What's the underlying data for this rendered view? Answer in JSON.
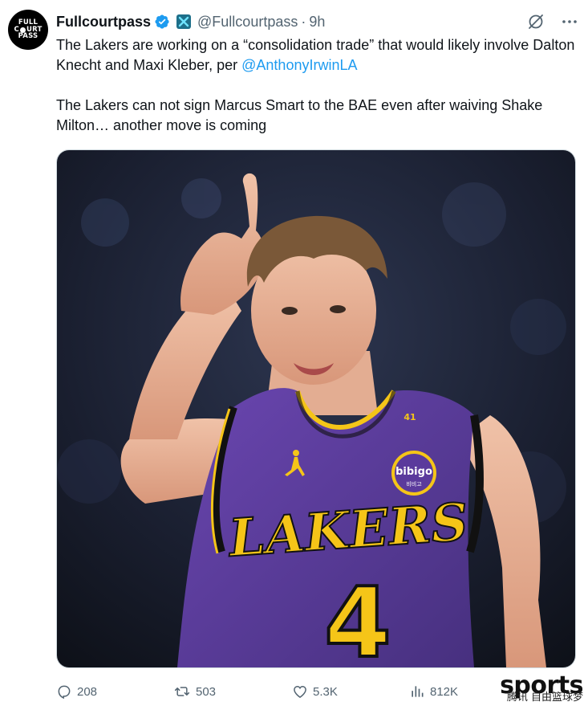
{
  "avatar": {
    "line1": "FULL",
    "line2a": "C",
    "line2b": "URT",
    "line3": "PASS"
  },
  "author": {
    "name": "Fullcourtpass",
    "handle": "@Fullcourtpass",
    "separator": "·",
    "time": "9h"
  },
  "tweet": {
    "p1_text": "The Lakers are working on a “consolidation trade” that would likely involve Dalton Knecht and Maxi Kleber, per ",
    "p1_mention": "@AnthonyIrwinLA",
    "p2_text": "The Lakers can not sign Marcus Smart to the BAE even after waiving Shake Milton… another move is coming"
  },
  "media": {
    "jersey_team": "LAKERS",
    "jersey_number": "4",
    "sponsor": "bibigo",
    "sponsor_sub": "비비고",
    "collar_number": "41"
  },
  "actions": {
    "replies": "208",
    "reposts": "503",
    "likes": "5.3K",
    "views": "812K"
  },
  "watermark": {
    "brand": "sports",
    "source": "腾讯 自由篮球梦"
  },
  "colors": {
    "accent": "#1d9bf0",
    "muted": "#536471",
    "text": "#0f1419",
    "purple": "#5b3a9c",
    "gold": "#f5c518"
  },
  "icons": [
    "verified-badge-icon",
    "x-affiliate-icon",
    "grok-icon",
    "more-icon",
    "reply-icon",
    "repost-icon",
    "like-icon",
    "views-icon"
  ]
}
